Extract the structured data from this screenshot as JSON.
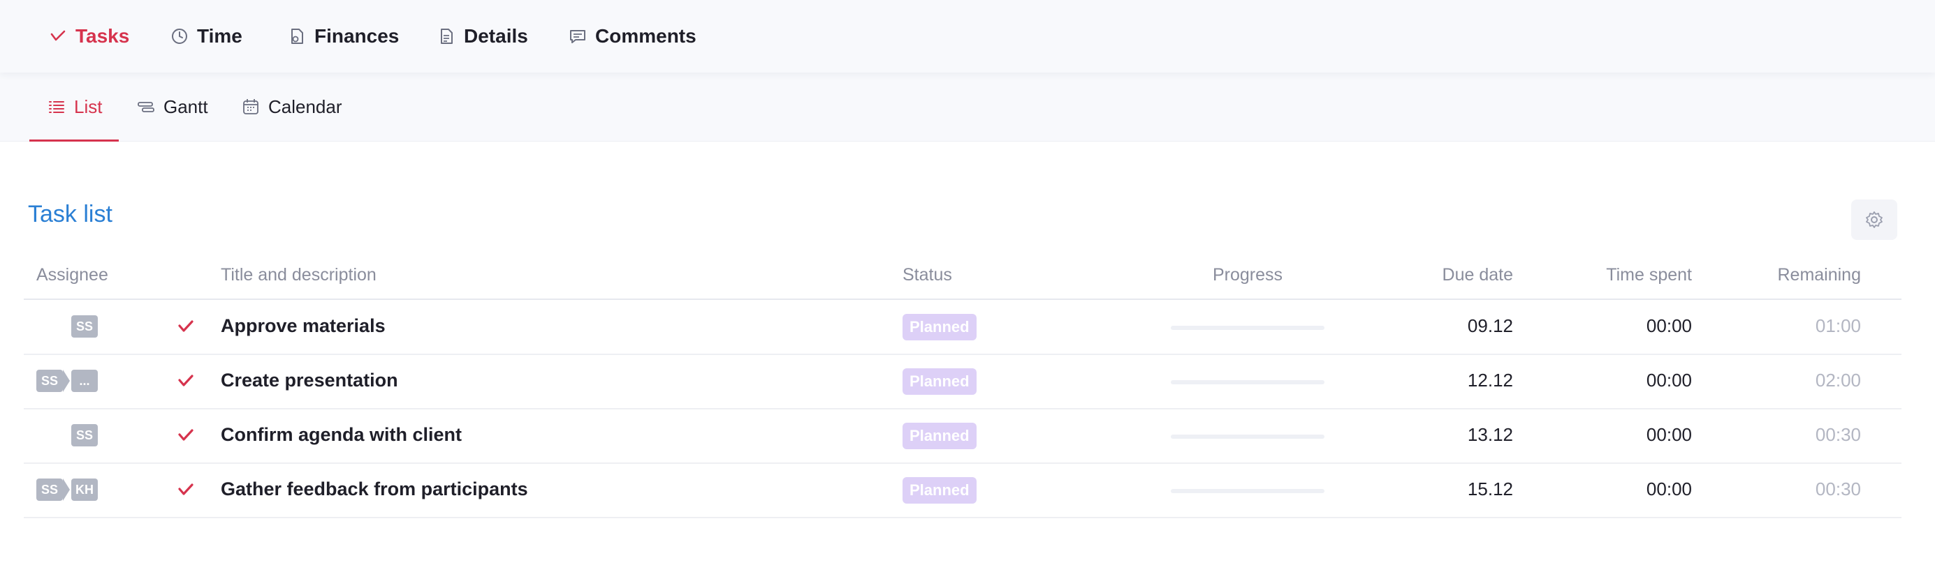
{
  "top_nav": {
    "tasks": "Tasks",
    "time": "Time",
    "finances": "Finances",
    "details": "Details",
    "comments": "Comments"
  },
  "sub_nav": {
    "list": "List",
    "gantt": "Gantt",
    "calendar": "Calendar"
  },
  "section": {
    "title": "Task list"
  },
  "table": {
    "headers": {
      "assignee": "Assignee",
      "title": "Title and description",
      "status": "Status",
      "progress": "Progress",
      "due_date": "Due date",
      "time_spent": "Time spent",
      "remaining": "Remaining"
    },
    "rows": [
      {
        "assignees": [
          "SS"
        ],
        "title": "Approve materials",
        "status": "Planned",
        "progress": 0,
        "due_date": "09.12",
        "time_spent": "00:00",
        "remaining": "01:00"
      },
      {
        "assignees": [
          "SS",
          "..."
        ],
        "title": "Create presentation",
        "status": "Planned",
        "progress": 0,
        "due_date": "12.12",
        "time_spent": "00:00",
        "remaining": "02:00"
      },
      {
        "assignees": [
          "SS"
        ],
        "title": "Confirm agenda with client",
        "status": "Planned",
        "progress": 0,
        "due_date": "13.12",
        "time_spent": "00:00",
        "remaining": "00:30"
      },
      {
        "assignees": [
          "SS",
          "KH"
        ],
        "title": "Gather feedback from participants",
        "status": "Planned",
        "progress": 0,
        "due_date": "15.12",
        "time_spent": "00:00",
        "remaining": "00:30"
      }
    ]
  },
  "colors": {
    "accent": "#d6334d",
    "link_blue": "#2a7fd4",
    "status_planned": "#ddd0f7",
    "avatar_gray": "#b2b7c3"
  },
  "icons": {
    "tasks": "check-icon",
    "time": "clock-icon",
    "finances": "money-document-icon",
    "details": "document-icon",
    "comments": "comment-icon",
    "list": "list-icon",
    "gantt": "gantt-icon",
    "calendar": "calendar-icon",
    "settings": "gear-icon"
  }
}
